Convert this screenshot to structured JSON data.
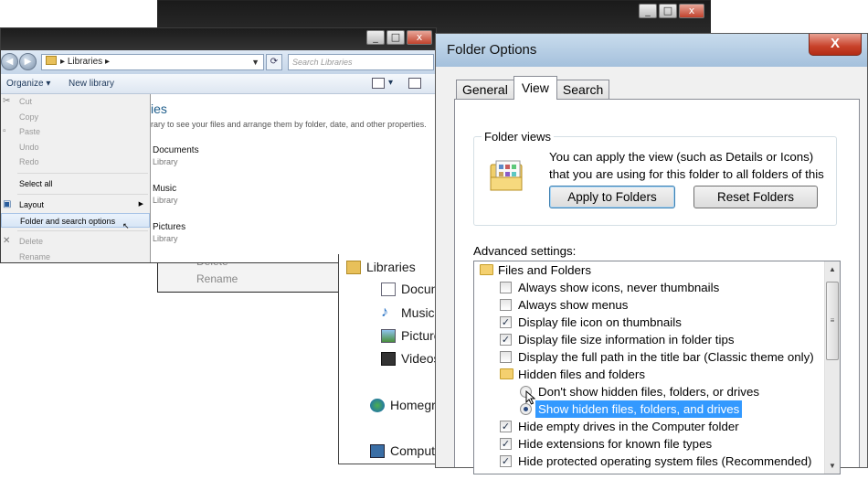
{
  "back_window": {
    "context_rest": [
      "Delete",
      "Rename"
    ]
  },
  "explorer": {
    "breadcrumb": "Libraries",
    "search_placeholder": "Search Libraries",
    "toolbar": {
      "organize": "Organize",
      "new_library": "New library"
    },
    "library_heading": "ies",
    "library_description": "rary to see your files and arrange them by folder, date, and other properties.",
    "libraries": [
      {
        "name": "Documents",
        "type": "Library"
      },
      {
        "name": "Music",
        "type": "Library"
      },
      {
        "name": "Pictures",
        "type": "Library"
      }
    ],
    "organize_menu": [
      {
        "label": "Cut",
        "enabled": false
      },
      {
        "label": "Copy",
        "enabled": false
      },
      {
        "label": "Paste",
        "enabled": false
      },
      {
        "label": "Undo",
        "enabled": false
      },
      {
        "label": "Redo",
        "enabled": false
      },
      {
        "label": "Select all",
        "enabled": true
      },
      {
        "label": "Layout",
        "enabled": true
      },
      {
        "label": "Folder and search options",
        "enabled": true,
        "highlighted": true
      },
      {
        "label": "Delete",
        "enabled": false
      },
      {
        "label": "Rename",
        "enabled": false
      }
    ]
  },
  "nav_pane": {
    "items": [
      "Libraries",
      "Docun",
      "Music",
      "Picture",
      "Videos",
      "Homegr",
      "Comput"
    ]
  },
  "dialog": {
    "title": "Folder Options",
    "close_label": "X",
    "tabs": [
      "General",
      "View",
      "Search"
    ],
    "active_tab": "View",
    "folder_views": {
      "legend": "Folder views",
      "description": "You can apply the view (such as Details or Icons) that you are using for this folder to all folders of this type.",
      "apply_button": "Apply to Folders",
      "reset_button": "Reset Folders"
    },
    "advanced_label": "Advanced settings:",
    "settings": [
      {
        "kind": "folder",
        "label": "Files and Folders"
      },
      {
        "kind": "checkbox",
        "label": "Always show icons, never thumbnails",
        "checked": false
      },
      {
        "kind": "checkbox",
        "label": "Always show menus",
        "checked": false
      },
      {
        "kind": "checkbox",
        "label": "Display file icon on thumbnails",
        "checked": true
      },
      {
        "kind": "checkbox",
        "label": "Display file size information in folder tips",
        "checked": true
      },
      {
        "kind": "checkbox",
        "label": "Display the full path in the title bar (Classic theme only)",
        "checked": false
      },
      {
        "kind": "folder",
        "label": "Hidden files and folders"
      },
      {
        "kind": "radio",
        "label": "Don't show hidden files, folders, or drives",
        "checked": false
      },
      {
        "kind": "radio",
        "label": "Show hidden files, folders, and drives",
        "checked": true,
        "selected": true
      },
      {
        "kind": "checkbox",
        "label": "Hide empty drives in the Computer folder",
        "checked": true
      },
      {
        "kind": "checkbox",
        "label": "Hide extensions for known file types",
        "checked": true
      },
      {
        "kind": "checkbox",
        "label": "Hide protected operating system files (Recommended)",
        "checked": true
      }
    ]
  },
  "colors": {
    "selection": "#3399ff",
    "title_gradient_top": "#c9dced",
    "close_red": "#c8412a"
  }
}
